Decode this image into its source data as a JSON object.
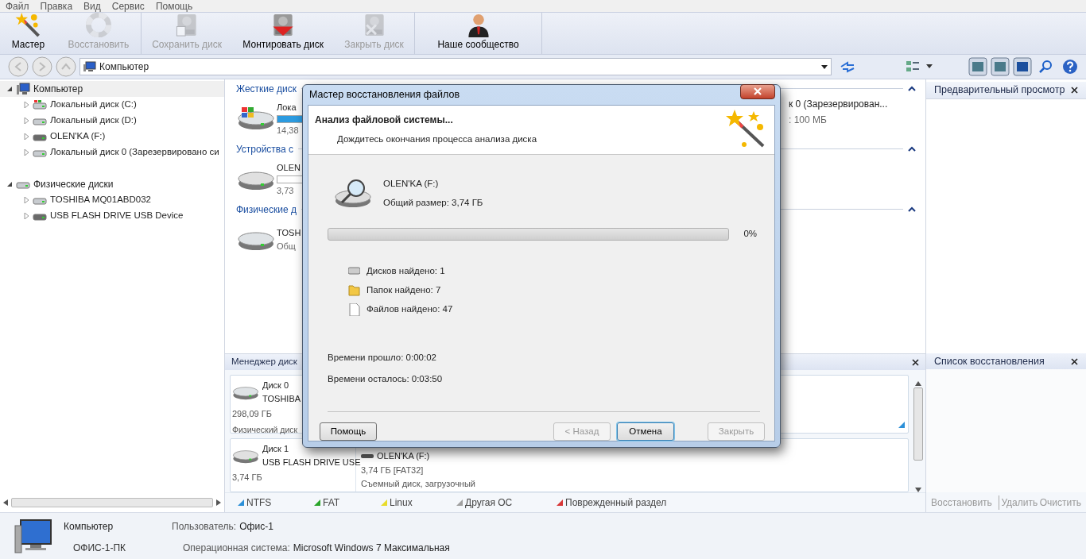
{
  "menu": [
    "Файл",
    "Правка",
    "Вид",
    "Сервис",
    "Помощь"
  ],
  "toolbar_groups": [
    [
      {
        "label": "Мастер",
        "kind": "wand",
        "disabled": false
      },
      {
        "label": "Восстановить",
        "kind": "lifebuoy",
        "disabled": true
      }
    ],
    [
      {
        "label": "Сохранить диск",
        "kind": "save-disk",
        "disabled": true
      },
      {
        "label": "Монтировать диск",
        "kind": "mount-disk",
        "disabled": false
      },
      {
        "label": "Закрыть диск",
        "kind": "close-disk",
        "disabled": true
      }
    ],
    [
      {
        "label": "Наше сообщество",
        "kind": "person",
        "disabled": false
      }
    ]
  ],
  "address": {
    "value": "Компьютер"
  },
  "tree": [
    {
      "label": "Компьютер",
      "kind": "computer",
      "expanded": true,
      "children": [
        {
          "label": "Локальный диск (C:)",
          "kind": "system",
          "expanded": false
        },
        {
          "label": "Локальный диск (D:)",
          "kind": "hdd",
          "expanded": false
        },
        {
          "label": "OLEN'KA (F:)",
          "kind": "usb",
          "expanded": false
        },
        {
          "label": "Локальный диск 0 (Зарезервировано си",
          "kind": "hdd",
          "expanded": false
        }
      ]
    },
    {
      "label": "Физические диски",
      "kind": "hdd",
      "expanded": true,
      "children": [
        {
          "label": "TOSHIBA MQ01ABD032",
          "kind": "hdd",
          "expanded": false
        },
        {
          "label": "USB FLASH DRIVE USB Device",
          "kind": "usb",
          "expanded": false
        }
      ]
    }
  ],
  "explorer_sections": [
    {
      "title": "Жесткие диск",
      "items": [
        {
          "name": "Лока",
          "kind": "system",
          "level": 0.6,
          "info": "14,38"
        }
      ],
      "far_item": {
        "name": "к 0 (Зарезервирован...",
        "info": ": 100 МБ"
      }
    },
    {
      "title": "Устройства с",
      "items": [
        {
          "name": "OLEN",
          "kind": "usb",
          "level": 0.0,
          "info": "3,73"
        }
      ]
    },
    {
      "title": "Физические д",
      "items": [
        {
          "name": "TOSH",
          "kind": "hdd",
          "info": "Общ"
        }
      ]
    }
  ],
  "preview_panel": {
    "title": "Предварительный просмотр"
  },
  "disk_manager": {
    "title": "Менеджер диск",
    "disks": [
      {
        "name": "Диск 0",
        "model": "TOSHIBA",
        "size": "298,09 ГБ",
        "type": "Физический диск",
        "kind": "hdd"
      },
      {
        "name": "Диск 1",
        "model": "USB FLASH DRIVE USE",
        "size": "3,74 ГБ",
        "kind": "usb",
        "partition": {
          "name": "OLEN'KA (F:)",
          "size": "3,74 ГБ [FAT32]",
          "type": "Съемный диск, загрузочный"
        }
      }
    ]
  },
  "legend": [
    {
      "label": "NTFS",
      "color": "#2b8fd8"
    },
    {
      "label": "FAT",
      "color": "#2aa52a"
    },
    {
      "label": "Linux",
      "color": "#e8dc2a"
    },
    {
      "label": "Другая ОС",
      "color": "#a0a0a0"
    },
    {
      "label": "Поврежденный раздел",
      "color": "#d83838"
    }
  ],
  "recovery_list": {
    "title": "Список восстановления",
    "actions": [
      "Восстановить",
      "Удалить",
      "Очистить"
    ]
  },
  "status": {
    "computer": "Компьютер",
    "host": "ОФИС-1-ПК",
    "user_label": "Пользователь:",
    "user": "Офис-1",
    "os_label": "Операционная система:",
    "os": "Microsoft Windows 7 Максимальная"
  },
  "dialog": {
    "title": "Мастер восстановления файлов",
    "heading": "Анализ файловой системы...",
    "subheading": "Дождитесь окончания процесса анализа диска",
    "disk_name": "OLEN'KA (F:)",
    "disk_size": "Общий размер: 3,74 ГБ",
    "progress": {
      "level": 0.0,
      "reading": "0%"
    },
    "stats": [
      {
        "label": "Дисков найдено: 1",
        "kind": "disk"
      },
      {
        "label": "Папок найдено: 7",
        "kind": "folder"
      },
      {
        "label": "Файлов найдено: 47",
        "kind": "file"
      }
    ],
    "times": [
      "Времени прошло: 0:00:02",
      "Времени осталось: 0:03:50"
    ],
    "buttons": [
      {
        "label": "Помощь",
        "disabled": false,
        "default": false
      },
      {
        "label": "< Назад",
        "disabled": true,
        "default": false
      },
      {
        "label": "Отмена",
        "disabled": false,
        "default": true
      },
      {
        "label": "Закрыть",
        "disabled": true,
        "default": false
      }
    ]
  }
}
